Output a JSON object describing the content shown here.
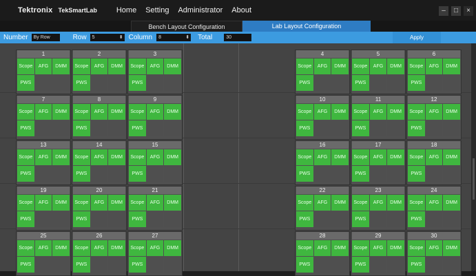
{
  "app": {
    "brand": "Tektronix",
    "product": "TekSmartLab",
    "menu": [
      "Home",
      "Setting",
      "Administrator",
      "About"
    ],
    "window_controls": [
      "–",
      "□",
      "×"
    ]
  },
  "tabs": {
    "bench_layout": "Bench Layout Configuration",
    "lab_layout": "Lab Layout Configuration"
  },
  "toolbar": {
    "number_label": "Number",
    "number_value": "By Row",
    "row_label": "Row",
    "row_value": "5",
    "column_label": "Column",
    "column_value": "8",
    "total_label": "Total",
    "total_value": "30",
    "apply_label": "Apply",
    "spin_glyph": "⬍"
  },
  "bench_instruments": [
    "Scope",
    "AFG",
    "DMM",
    "PWS"
  ],
  "benches": [
    "1",
    "2",
    "3",
    "4",
    "5",
    "6",
    "7",
    "8",
    "9",
    "10",
    "11",
    "12",
    "13",
    "14",
    "15",
    "16",
    "17",
    "18",
    "19",
    "20",
    "21",
    "22",
    "23",
    "24",
    "25",
    "26",
    "27",
    "28",
    "29",
    "30"
  ],
  "colors": {
    "accent_blue": "#3c9be0",
    "active_tab": "#2e7cc3",
    "instrument_green": "#3fb73f",
    "background": "#444444"
  }
}
